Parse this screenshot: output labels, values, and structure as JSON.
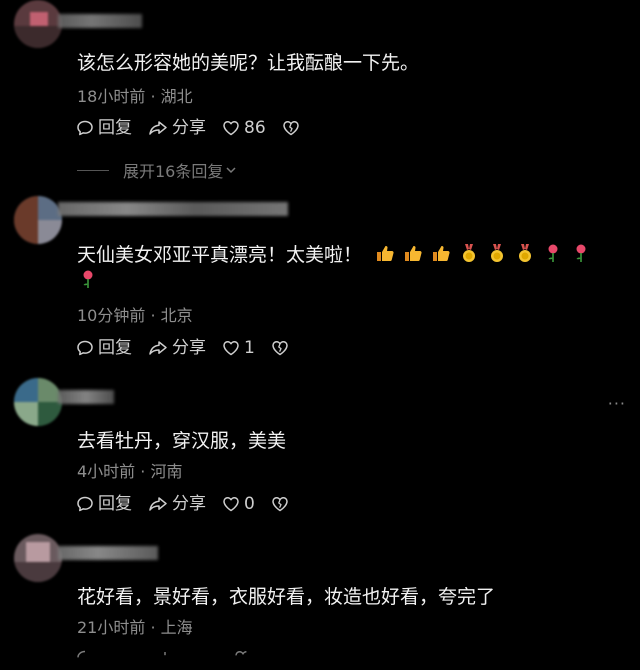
{
  "comments": [
    {
      "text": "该怎么形容她的美呢？让我酝酿一下先。",
      "time": "18小时前",
      "location": "湖北",
      "reply_label": "回复",
      "share_label": "分享",
      "likes": "86",
      "expand_label": "展开16条回复"
    },
    {
      "text": "天仙美女邓亚平真漂亮！太美啦！",
      "emojis": [
        "thumbs-up",
        "thumbs-up",
        "thumbs-up",
        "medal",
        "medal",
        "medal",
        "rose",
        "rose",
        "rose"
      ],
      "time": "10分钟前",
      "location": "北京",
      "reply_label": "回复",
      "share_label": "分享",
      "likes": "1"
    },
    {
      "text": "去看牡丹，穿汉服，美美",
      "time": "4小时前",
      "location": "河南",
      "reply_label": "回复",
      "share_label": "分享",
      "likes": "0",
      "more_label": "···"
    },
    {
      "text": "花好看，景好看，衣服好看，妆造也好看，夸完了",
      "time": "21小时前",
      "location": "上海"
    }
  ],
  "separator": " · ",
  "colors": {
    "background": "#000000",
    "text": "#f2f2f2",
    "meta": "#8e8e8e",
    "action": "#cfcfcf"
  }
}
